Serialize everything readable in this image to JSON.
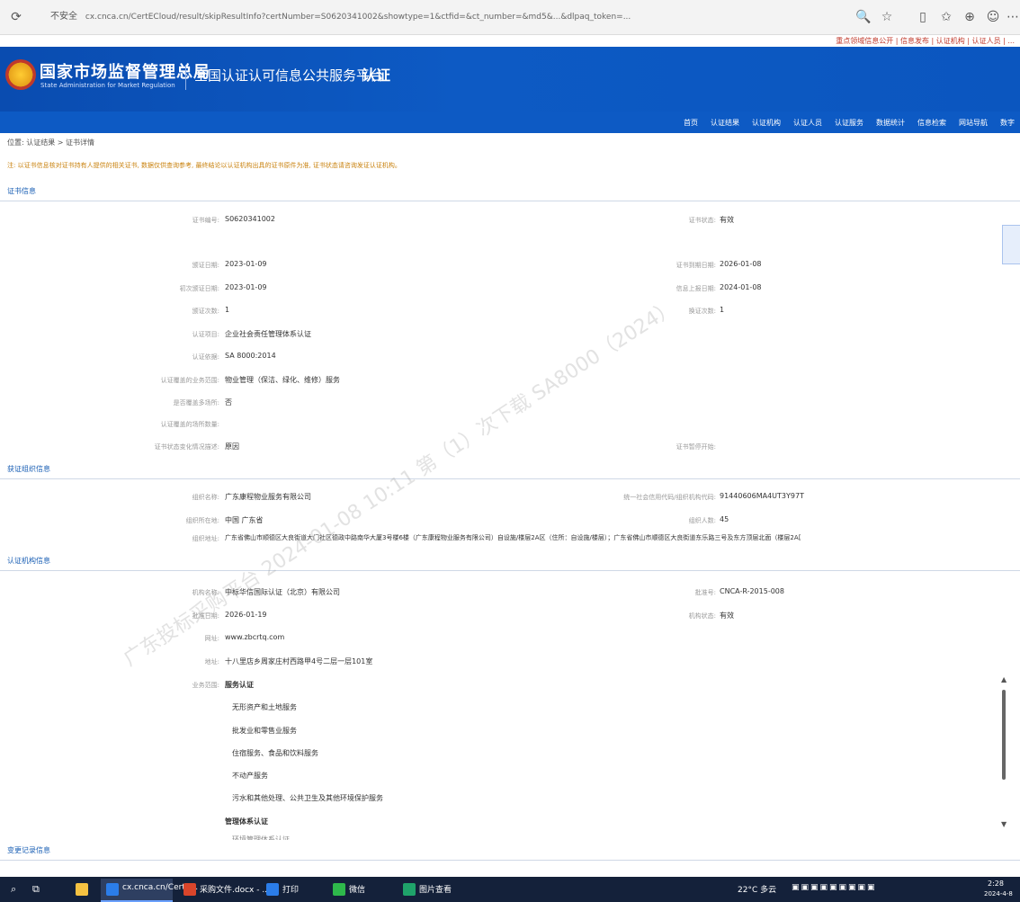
{
  "browser": {
    "secure_label": "不安全",
    "url": "cx.cnca.cn/CertECloud/result/skipResultInfo?certNumber=S0620341002&showtype=1&ctfid=&ct_number=&md5&...&dlpaq_token=...",
    "red_links": "重点领域信息公开 | 信息发布 | 认证机构 | 认证人员 | ..."
  },
  "header": {
    "agency_cn": "国家市场监督管理总局",
    "agency_en": "State Administration for Market Regulation",
    "platform_title": "全国认证认可信息公共服务平台",
    "platform_logo": "认证"
  },
  "nav": {
    "items": [
      "首页",
      "认证结果",
      "认证机构",
      "认证人员",
      "认证服务",
      "数据统计",
      "信息检索",
      "网站导航",
      "数字"
    ]
  },
  "breadcrumb": "位置: 认证结果 > 证书详情",
  "notice": "注: 以证书信息核对证书持有人提供的相关证书, 数据仅供查询参考, 最终结论以认证机构出具的证书原件为准, 证书状态请咨询发证认证机构。",
  "sections": {
    "cert_info": "证书信息",
    "holder_info": "获证组织信息",
    "agency_info": "认证机构信息",
    "record_info": "变更记录信息"
  },
  "cert": {
    "cert_number_label": "证书编号:",
    "cert_number": "S0620341002",
    "cert_status_label": "证书状态:",
    "cert_status": "有效",
    "issue_date_label": "颁证日期:",
    "issue_date": "2023-01-09",
    "expire_date_label": "证书到期日期:",
    "expire_date": "2026-01-08",
    "change_date_label": "初次颁证日期:",
    "change_date": "2023-01-09",
    "next_date_label": "信息上报日期:",
    "next_date": "2024-01-08",
    "count_label": "颁证次数:",
    "count": "1",
    "count2_label": "换证次数:",
    "count2": "1",
    "project_label": "认证项目:",
    "project": "企业社会责任管理体系认证",
    "standard_label": "认证依据:",
    "standard": "SA 8000:2014",
    "scope_label": "认证覆盖的业务范围:",
    "scope": "物业管理（保洁、绿化、维修）服务",
    "mutual_label": "是否覆盖多场所:",
    "mutual": "否",
    "other_label": "认证覆盖的场所数量:",
    "other": "",
    "eval_label": "证书状态变化情况描述:",
    "eval": "原因",
    "remark_label": "证书暂停开始:",
    "remark": ""
  },
  "holder": {
    "name_label": "组织名称:",
    "name": "广东康程物业服务有限公司",
    "credit_label": "统一社会信用代码/组织机构代码:",
    "credit": "91440606MA4UT3Y97T",
    "region_label": "组织所在地:",
    "region": "中国 广东省",
    "type_label": "组织人数:",
    "type": "45",
    "address_label": "组织地址:",
    "address": "广东省佛山市顺德区大良街道大门社区德政中路南华大厦3号楼6楼（广东康程物业服务有限公司）自设施/楼层2A区（住所：自设施/楼层）；广东省佛山市顺德区大良街道东乐路三号及东方顶层北面（楼层2A区）"
  },
  "agency": {
    "name_label": "机构名称:",
    "name": "中标华信国际认证（北京）有限公司",
    "approval_label": "批准号:",
    "approval": "CNCA-R-2015-008",
    "date_label": "批准日期:",
    "date": "2026-01-19",
    "status_label": "机构状态:",
    "status": "有效",
    "web_label": "网址:",
    "web": "www.zbcrtq.com",
    "addr_label": "地址:",
    "addr": "十八里店乡周家庄村西路甲4号二层一层101室",
    "cat_label": "业务范围:",
    "cat": "服务认证",
    "items": [
      "无形资产和土地服务",
      "批发业和零售业服务",
      "住宿服务、食品和饮料服务",
      "不动产服务",
      "污水和其他处理、公共卫生及其他环境保护服务"
    ],
    "sub": "管理体系认证",
    "cut": "环境管理体系认证"
  },
  "watermark": "广东投标采购平台 2024-01-08 10:11 第（1）次下载 SA8000（2024）",
  "taskbar": {
    "items": [
      "cx.cnca.cn/CertE...",
      "采购文件.docx - ...",
      "打印",
      "微信",
      "图片查看"
    ],
    "weather": "22°C 多云",
    "time": "2:28",
    "date": "2024-4-8"
  }
}
